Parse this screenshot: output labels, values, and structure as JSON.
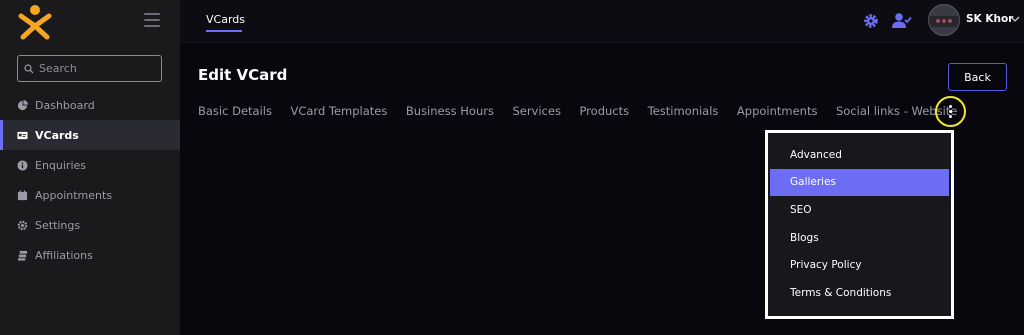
{
  "colors": {
    "accent": "#6c6cf5",
    "highlight_ring": "#f1e52e",
    "logo": "#f5a623",
    "background": "#07070d",
    "sidebar": "#1a1a1d"
  },
  "sidebar": {
    "logo_icon": "asterisk-person-logo",
    "search": {
      "placeholder": "Search",
      "value": ""
    },
    "items": [
      {
        "label": "Dashboard",
        "icon": "pie-chart-icon",
        "active": false
      },
      {
        "label": "VCards",
        "icon": "id-card-icon",
        "active": true
      },
      {
        "label": "Enquiries",
        "icon": "info-icon",
        "active": false
      },
      {
        "label": "Appointments",
        "icon": "calendar-icon",
        "active": false
      },
      {
        "label": "Settings",
        "icon": "gear-icon",
        "active": false
      },
      {
        "label": "Affiliations",
        "icon": "layers-icon",
        "active": false
      }
    ]
  },
  "topbar": {
    "tab": "VCards",
    "user": {
      "name": "SK Khor"
    }
  },
  "main": {
    "title": "Edit VCard",
    "back_label": "Back",
    "tabs": [
      "Basic Details",
      "VCard Templates",
      "Business Hours",
      "Services",
      "Products",
      "Testimonials",
      "Appointments",
      "Social links - Website"
    ]
  },
  "dropdown": {
    "items": [
      {
        "label": "Advanced",
        "active": false
      },
      {
        "label": "Galleries",
        "active": true
      },
      {
        "label": "SEO",
        "active": false
      },
      {
        "label": "Blogs",
        "active": false
      },
      {
        "label": "Privacy Policy",
        "active": false
      },
      {
        "label": "Terms & Conditions",
        "active": false
      }
    ]
  }
}
